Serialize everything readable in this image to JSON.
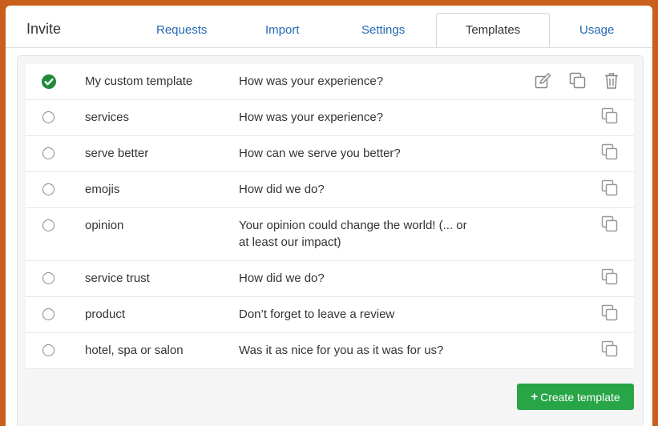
{
  "header": {
    "title": "Invite",
    "tabs": [
      {
        "label": "Requests"
      },
      {
        "label": "Import"
      },
      {
        "label": "Settings"
      },
      {
        "label": "Templates"
      },
      {
        "label": "Usage"
      }
    ],
    "active_tab": "Templates"
  },
  "templates": [
    {
      "name": "My custom template",
      "question": "How was your experience?",
      "selected": true
    },
    {
      "name": "services",
      "question": "How was your experience?",
      "selected": false
    },
    {
      "name": "serve better",
      "question": "How can we serve you better?",
      "selected": false
    },
    {
      "name": "emojis",
      "question": "How did we do?",
      "selected": false
    },
    {
      "name": "opinion",
      "question": "Your opinion could change the world! (... or at least our impact)",
      "selected": false
    },
    {
      "name": "service trust",
      "question": "How did we do?",
      "selected": false
    },
    {
      "name": "product",
      "question": "Don’t forget to leave a review",
      "selected": false
    },
    {
      "name": "hotel, spa or salon",
      "question": "Was it as nice for you as it was for us?",
      "selected": false
    }
  ],
  "create_button": {
    "label": "Create template",
    "icon": "plus-icon"
  },
  "colors": {
    "accent": "#2469b3",
    "success": "#27a547",
    "check": "#1e8a3a",
    "background": "#c95f1a"
  }
}
